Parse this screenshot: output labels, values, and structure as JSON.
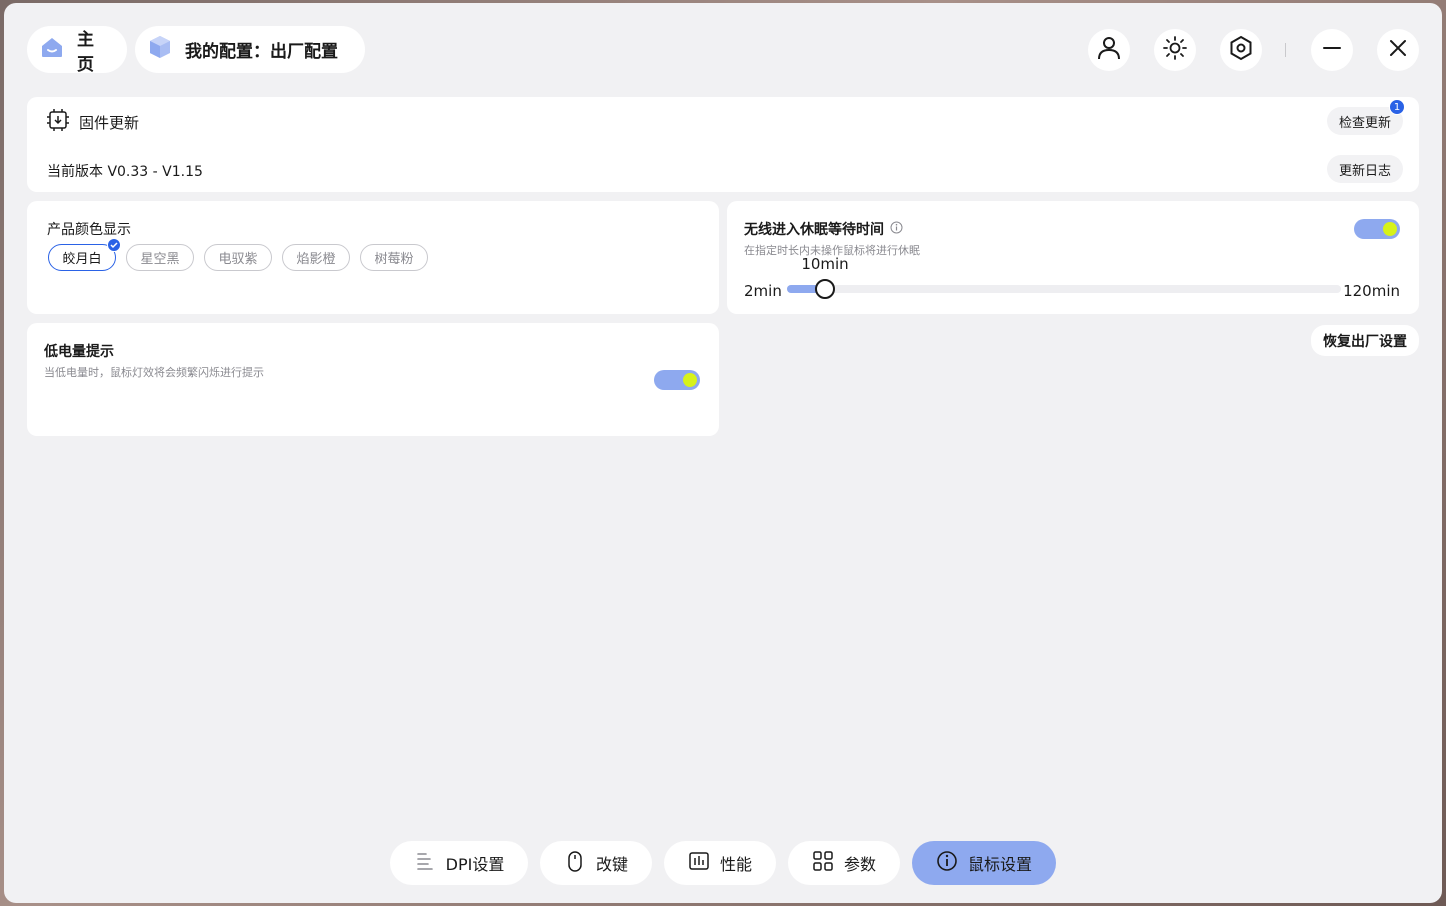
{
  "header": {
    "home_label": "主页",
    "config_label": "我的配置：出厂配置",
    "icons": [
      "user-icon",
      "brightness-icon",
      "settings-hex-icon",
      "minimize-icon",
      "close-icon"
    ]
  },
  "firmware": {
    "title": "固件更新",
    "version_label": "当前版本 V0.33 - V1.15",
    "check_update_label": "检查更新",
    "check_update_badge": "1",
    "changelog_label": "更新日志"
  },
  "color_display": {
    "title": "产品颜色显示",
    "options": [
      "皎月白",
      "星空黑",
      "电驭紫",
      "焰影橙",
      "树莓粉"
    ],
    "selected": "皎月白"
  },
  "sleep": {
    "title": "无线进入休眠等待时间",
    "subtitle": "在指定时长内未操作鼠标将进行休眠",
    "enabled": true,
    "min_label": "2min",
    "max_label": "120min",
    "value_label": "10min",
    "value_fraction": 0.068
  },
  "low_battery": {
    "title": "低电量提示",
    "subtitle": "当低电量时，鼠标灯效将会频繁闪烁进行提示",
    "enabled": true
  },
  "reset_label": "恢复出厂设置",
  "nav": {
    "items": [
      "DPI设置",
      "改键",
      "性能",
      "参数",
      "鼠标设置"
    ],
    "active": "鼠标设置"
  },
  "colors": {
    "accent": "#8ea9ef",
    "toggle_knob": "#d7f21a",
    "badge_blue": "#2a62e6"
  }
}
